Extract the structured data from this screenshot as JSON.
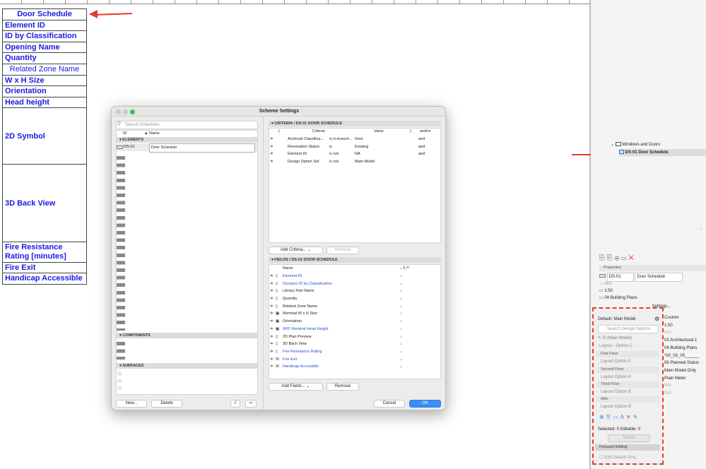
{
  "schedule_rows": [
    "Door Schedule",
    "Element ID",
    "ID by Classification",
    "Opening Name",
    "Quantity",
    "Related Zone Name",
    "W x H Size",
    "Orientation",
    "Head height",
    "2D Symbol",
    "3D Back View",
    "Fire Resistance Rating [minutes]",
    "Fire Exit",
    "Handicap Accessible"
  ],
  "dialog": {
    "title": "Scheme Settings",
    "search_placeholder": "Search Schedules",
    "col_id": "ID",
    "col_name": "▲ Name",
    "section_elements": "ELEMENTS",
    "selected_id": "DS-01",
    "selected_name": "Door Schedule",
    "section_components": "COMPONENTS",
    "section_surfaces": "SURFACES",
    "new_btn": "New...",
    "delete_btn": "Delete",
    "criteria_header": "CRITERIA / DS-01 DOOR SCHEDULE",
    "criteria_cols": {
      "open": "(",
      "criteria": "Criteria",
      "value": "Value",
      "close": ")",
      "andor": "and/or"
    },
    "criteria_rows": [
      {
        "criteria": "Archicad Classifica...",
        "op": "is in branch...",
        "value": "Door",
        "andor": "and"
      },
      {
        "criteria": "Renovation Status",
        "op": "is",
        "value": "Existing",
        "andor": "and"
      },
      {
        "criteria": "Element ID",
        "op": "is not",
        "value": "NA",
        "andor": "and"
      },
      {
        "criteria": "Design Option Set",
        "op": "is not",
        "value": "Main Model",
        "andor": ""
      }
    ],
    "add_criteria_btn": "Add Criteria...",
    "remove_btn": "Remove",
    "fields_header": "FIELDS / DS-01 DOOR SCHEDULE",
    "fields_col_name": "Name",
    "fields_col_icons": "↓ Σ ⁄ꟹ",
    "fields": [
      {
        "name": "Element ID",
        "blue": true
      },
      {
        "name": "Dynamic ID by Classification",
        "blue": true
      },
      {
        "name": "Library Part Name",
        "blue": false
      },
      {
        "name": "Quantity",
        "blue": false
      },
      {
        "name": "Related Zone Name",
        "blue": false
      },
      {
        "name": "Nominal W x H Size",
        "blue": false
      },
      {
        "name": "Orientation",
        "blue": false
      },
      {
        "name": "W/D Nominal Head Height",
        "blue": true
      },
      {
        "name": "2D Plan Preview",
        "blue": false
      },
      {
        "name": "3D Back View",
        "blue": false
      },
      {
        "name": "Fire Resistance Rating",
        "blue": true
      },
      {
        "name": "Fire Exit",
        "blue": true
      },
      {
        "name": "Handicap Accessible",
        "blue": true
      }
    ],
    "add_fields_btn": "Add Fields...",
    "cancel_btn": "Cancel",
    "ok_btn": "OK"
  },
  "navigator": {
    "folder": "Windows and Doors",
    "item": "DS-01 Door Schedule"
  },
  "properties": {
    "header": "Properties",
    "id": "DS-01",
    "name": "Door Schedule",
    "na": "N/A",
    "scale": "1:50",
    "layer": "04 Building Plans",
    "settings_btn": "Settings..."
  },
  "design_options": {
    "default": "Default: Main Model",
    "search": "Search Design Options",
    "main_model": "(Main Model)",
    "layout_c": "Layout - Option C",
    "first_floor": "First Floor",
    "opt_e": "Layout Option E",
    "second_floor": "Second Floor",
    "opt_a": "Layout Option A",
    "third_floor": "Third Floor",
    "opt_b": "Layout Option B",
    "attic": "Attic",
    "opt_b2": "Layout Option B",
    "selected_editable": "Selected: 0 Editable: 0",
    "relink": "Relink",
    "focused_editing": "Focused Editing",
    "edit_default": "Edit Default Only"
  },
  "side_values": [
    "Custom",
    "1:50",
    "N/A",
    "03 Architectural 1",
    "04 Building Plans",
    "*00_03_00______",
    "06 Planned Status",
    "Main Model Only",
    "Plain Meter",
    "N/A",
    "N/A"
  ],
  "colors": {
    "accent_red": "#e53b2c",
    "schedule_blue": "#1a1ae6",
    "ok_blue": "#3b8ef6"
  }
}
